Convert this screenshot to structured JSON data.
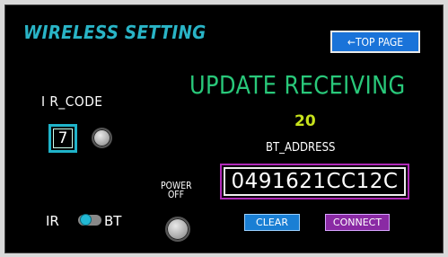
{
  "header": {
    "title": "WIRELESS SETTING",
    "top_page_label": "←TOP PAGE"
  },
  "status": {
    "text": "UPDATE RECEIVING",
    "count": "20"
  },
  "bt": {
    "label": "BT_ADDRESS",
    "address": "0491621CC12C",
    "clear_label": "CLEAR",
    "connect_label": "CONNECT"
  },
  "ir": {
    "code_label": "I R_CODE",
    "code_value": "7"
  },
  "power": {
    "line1": "POWER",
    "line2": "OFF"
  },
  "mode_toggle": {
    "left_label": "IR",
    "right_label": "BT",
    "selected": "IR"
  },
  "colors": {
    "title": "#29b4c6",
    "status": "#29c87a",
    "count": "#c7e21c",
    "clear_button": "#1a7fd4",
    "connect_button": "#8a2aa4",
    "address_border": "#b02ab8"
  }
}
